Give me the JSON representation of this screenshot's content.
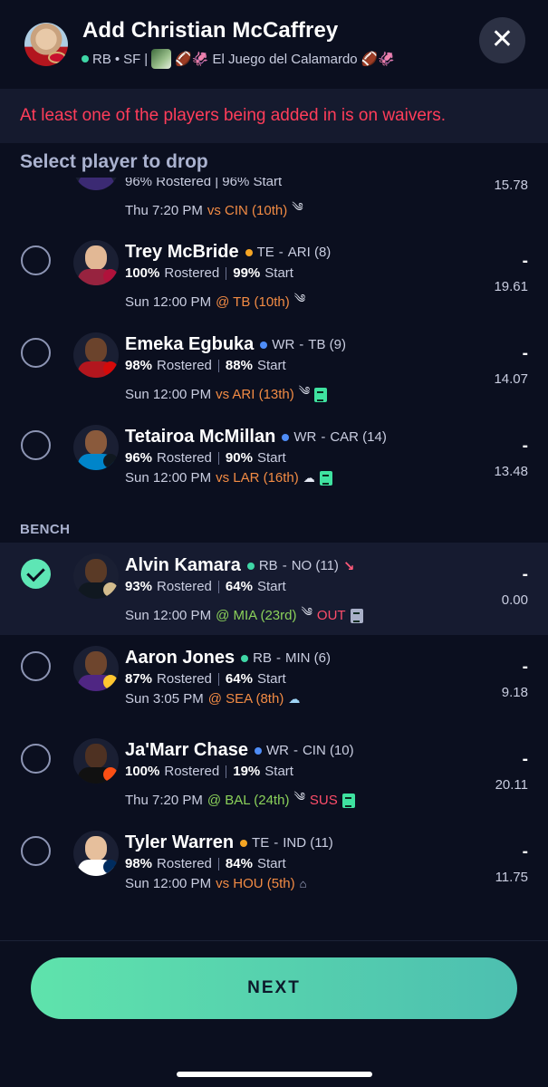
{
  "header": {
    "title": "Add Christian McCaffrey",
    "position": "RB",
    "bullet": "•",
    "team": "SF",
    "divider": "|",
    "league_emoji_prefix": "🏈🦑",
    "league_name": "El Juego del Calamardo",
    "league_emoji_suffix": "🏈🦑",
    "close_icon": "✕"
  },
  "banner": {
    "text": "At least one of the players being added in is on waivers."
  },
  "select_label": "Select player to drop",
  "partial_row": {
    "stats_text": "96% Rostered | 96% Start",
    "game_time": "Thu 7:20 PM",
    "opponent": "vs CIN (10th)",
    "points": "15.78"
  },
  "starters": [
    {
      "name": "Trey McBride",
      "pos": "TE",
      "pos_color": "#f5a524",
      "team": "ARI (8)",
      "rostered": "100%",
      "rostered_label": "Rostered",
      "start": "99%",
      "start_label": "Start",
      "game_time": "Sun 12:00 PM",
      "opponent": "@ TB (10th)",
      "opp_kind": "hard",
      "weather": "wind-icon",
      "dash": "-",
      "points": "19.61"
    },
    {
      "name": "Emeka Egbuka",
      "pos": "WR",
      "pos_color": "#4f8df7",
      "team": "TB (9)",
      "rostered": "98%",
      "rostered_label": "Rostered",
      "start": "88%",
      "start_label": "Start",
      "game_time": "Sun 12:00 PM",
      "opponent": "vs ARI (13th)",
      "opp_kind": "hard",
      "weather": "wind-icon",
      "dash": "-",
      "points": "14.07"
    },
    {
      "name": "Tetairoa McMillan",
      "pos": "WR",
      "pos_color": "#4f8df7",
      "team": "CAR (14)",
      "rostered": "96%",
      "rostered_label": "Rostered",
      "start": "90%",
      "start_label": "Start",
      "game_time": "Sun 12:00 PM",
      "opponent": "vs LAR (16th)",
      "opp_kind": "hard",
      "weather": "cloud-icon",
      "dash": "-",
      "points": "13.48"
    }
  ],
  "bench_label": "BENCH",
  "bench": [
    {
      "name": "Alvin Kamara",
      "pos": "RB",
      "pos_color": "#3fd6a6",
      "team": "NO (11)",
      "trend": "↘",
      "rostered": "93%",
      "rostered_label": "Rostered",
      "start": "64%",
      "start_label": "Start",
      "game_time": "Sun 12:00 PM",
      "opponent": "@ MIA (23rd)",
      "opp_kind": "easy",
      "weather": "wind-icon",
      "status": "OUT",
      "dash": "-",
      "points": "0.00",
      "selected": true
    },
    {
      "name": "Aaron Jones",
      "pos": "RB",
      "pos_color": "#3fd6a6",
      "team": "MIN (6)",
      "rostered": "87%",
      "rostered_label": "Rostered",
      "start": "64%",
      "start_label": "Start",
      "game_time": "Sun 3:05 PM",
      "opponent": "@ SEA (8th)",
      "opp_kind": "hard",
      "weather": "cloud-icon",
      "dash": "-",
      "points": "9.18"
    },
    {
      "name": "Ja'Marr Chase",
      "pos": "WR",
      "pos_color": "#4f8df7",
      "team": "CIN (10)",
      "rostered": "100%",
      "rostered_label": "Rostered",
      "start": "19%",
      "start_label": "Start",
      "game_time": "Thu 7:20 PM",
      "opponent": "@ BAL (24th)",
      "opp_kind": "easy",
      "weather": "wind-icon",
      "status": "SUS",
      "dash": "-",
      "points": "20.11"
    },
    {
      "name": "Tyler Warren",
      "pos": "TE",
      "pos_color": "#f5a524",
      "team": "IND (11)",
      "rostered": "98%",
      "rostered_label": "Rostered",
      "start": "84%",
      "start_label": "Start",
      "game_time": "Sun 12:00 PM",
      "opponent": "vs HOU (5th)",
      "opp_kind": "hard",
      "weather": "dome-icon",
      "dash": "-",
      "points": "11.75"
    }
  ],
  "next_button": "NEXT"
}
